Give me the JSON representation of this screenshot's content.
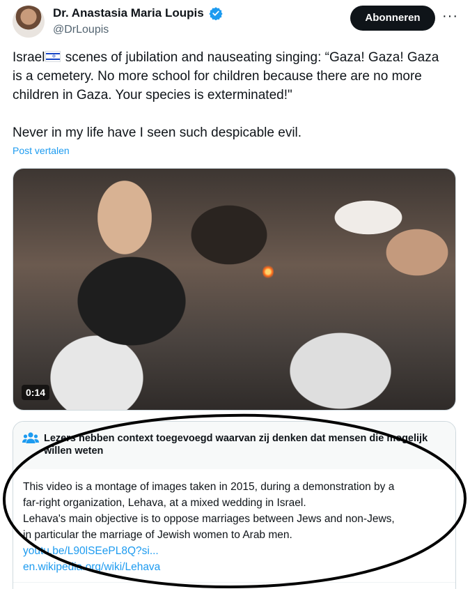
{
  "author": {
    "name": "Dr. Anastasia Maria Loupis",
    "handle": "@DrLoupis",
    "verified_color": "#1d9bf0"
  },
  "actions": {
    "subscribe_label": "Abonneren",
    "more_label": "···"
  },
  "tweet": {
    "line1_before_flag": "Israel",
    "line1_after_flag": " scenes of jubilation and nauseating singing: “Gaza! Gaza! Gaza",
    "line2": "is a cemetery. No more school for children because there are no more",
    "line3": "children in Gaza. Your species is exterminated!\"",
    "line4": "Never in my life have I seen such despicable evil.",
    "flag_icon": "israel-flag-icon",
    "translate_label": "Post vertalen"
  },
  "video": {
    "duration": "0:14"
  },
  "community_note": {
    "title": "Lezers hebben context toegevoegd waarvan zij denken dat mensen die mogelijk willen weten",
    "body_line1": "This video is a montage of images taken in 2015, during a demonstration by a",
    "body_line2": "far-right organization, Lehava, at a mixed wedding in Israel.",
    "body_line3": "Lehava's main objective is to oppose marriages between Jews and non-Jews,",
    "body_line4": "in particular the marriage of Jewish women to Arab men.",
    "link1": "youtu.be/L90lSEePL8Q?si...",
    "link2": "en.wikipedia.org/wiki/Lehava",
    "icon": "people-icon",
    "accent_color": "#1d9bf0"
  }
}
